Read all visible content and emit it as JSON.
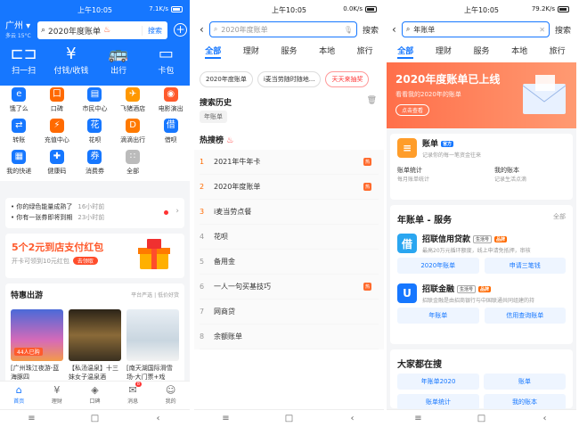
{
  "status_bars": [
    {
      "time": "上午10:05",
      "net": "7.1K/s",
      "battery": "77"
    },
    {
      "time": "上午10:05",
      "net": "0.0K/s",
      "battery": "77"
    },
    {
      "time": "上午10:05",
      "net": "79.2K/s",
      "battery": "77"
    }
  ],
  "p1": {
    "city": "广州",
    "weather": "多云 15°C",
    "search_text": "2020年度账单",
    "search_btn": "搜索",
    "big": [
      {
        "label": "扫一扫",
        "icon": "scan-icon"
      },
      {
        "label": "付钱/收钱",
        "icon": "pay-icon"
      },
      {
        "label": "出行",
        "icon": "bus-icon"
      },
      {
        "label": "卡包",
        "icon": "card-icon"
      }
    ],
    "grid": [
      {
        "label": "饿了么",
        "icon": "eleme-icon",
        "color": "#1677ff"
      },
      {
        "label": "口碑",
        "icon": "koubei-icon",
        "color": "#ff6a00"
      },
      {
        "label": "市民中心",
        "icon": "citizen-icon",
        "color": "#1677ff"
      },
      {
        "label": "飞猪酒店",
        "icon": "hotel-icon",
        "color": "#ff9800"
      },
      {
        "label": "电影演出",
        "icon": "movie-icon",
        "color": "#ff5a2c"
      },
      {
        "label": "转账",
        "icon": "transfer-icon",
        "color": "#1677ff"
      },
      {
        "label": "充值中心",
        "icon": "topup-icon",
        "color": "#ff6a00"
      },
      {
        "label": "花呗",
        "icon": "huabei-icon",
        "color": "#1677ff"
      },
      {
        "label": "滴滴出行",
        "icon": "didi-icon",
        "color": "#ff7a00"
      },
      {
        "label": "借呗",
        "icon": "jiebei-icon",
        "color": "#1677ff"
      },
      {
        "label": "我的快递",
        "icon": "express-icon",
        "color": "#1677ff"
      },
      {
        "label": "健康码",
        "icon": "health-code-icon",
        "color": "#1677ff"
      },
      {
        "label": "消费券",
        "icon": "coupon-icon",
        "color": "#1677ff"
      },
      {
        "label": "全部",
        "icon": "all-icon",
        "color": "#bbb"
      }
    ],
    "notices": [
      {
        "text": "你的绿色能量成熟了",
        "time": "16小时前"
      },
      {
        "text": "你有一张券即将到期",
        "time": "23小时前"
      }
    ],
    "promo": {
      "title": "5个2元到店支付红包",
      "sub": "开卡可领到10元红包",
      "go": "去领取"
    },
    "travel": {
      "title": "特惠出游",
      "tags": "平台严选 | 低价好货",
      "badge": "44人已购",
      "items": [
        {
          "cap": "[广州珠江夜游-蓝海豚四"
        },
        {
          "cap": "【私汤温泉】十三妹女子温泉酒"
        },
        {
          "cap": "[南天湖国际滑雪场-大门票+戏"
        }
      ]
    },
    "tabs": [
      {
        "label": "首页",
        "icon": "home-icon"
      },
      {
        "label": "理财",
        "icon": "finance-icon"
      },
      {
        "label": "口碑",
        "icon": "koubei-tab-icon"
      },
      {
        "label": "消息",
        "icon": "message-icon",
        "badge": "8"
      },
      {
        "label": "我的",
        "icon": "profile-icon"
      }
    ]
  },
  "p2": {
    "search_text": "2020年度账单",
    "search_btn": "搜索",
    "tabs": [
      "全部",
      "理财",
      "服务",
      "本地",
      "旅行"
    ],
    "chips": [
      "2020年度账单",
      "i麦当劳随时随地...",
      "天天来抽奖"
    ],
    "history_title": "搜索历史",
    "history": [
      "年账单"
    ],
    "hot_title": "热搜榜",
    "hot": [
      {
        "n": "1",
        "t": "2021年牛年卡",
        "tag": "热"
      },
      {
        "n": "2",
        "t": "2020年度账单",
        "tag": "热"
      },
      {
        "n": "3",
        "t": "i麦当劳点餐",
        "tag": ""
      },
      {
        "n": "4",
        "t": "花呗",
        "tag": ""
      },
      {
        "n": "5",
        "t": "备用金",
        "tag": ""
      },
      {
        "n": "6",
        "t": "一人一句买基技巧",
        "tag": "热"
      },
      {
        "n": "7",
        "t": "网商贷",
        "tag": ""
      },
      {
        "n": "8",
        "t": "余额账单",
        "tag": ""
      }
    ]
  },
  "p3": {
    "search_text": "年账单",
    "search_btn": "搜索",
    "tabs": [
      "全部",
      "理财",
      "服务",
      "本地",
      "旅行"
    ],
    "banner": {
      "title": "2020年度账单已上线",
      "sub": "看看我的2020年的账单",
      "btn": "点击查看"
    },
    "bill": {
      "name": "账单",
      "badge": "官方",
      "desc": "记录你的每一笔资金往来",
      "a": "账单统计",
      "a_sub": "每月账单统计",
      "b": "我的账本",
      "b_sub": "记录生活点滴"
    },
    "svc_title": "年账单 - 服务",
    "svc_all": "全部",
    "svcs": [
      {
        "name": "招联信用贷款",
        "badge1": "生活号",
        "badge2": "品牌",
        "desc": "最高20万元循环额度，线上申请免抵押，审核",
        "logo_text": "借",
        "logo_color": "#2aa6f0",
        "btns": [
          "2020年账单",
          "申请三笔钱"
        ]
      },
      {
        "name": "招联金融",
        "badge1": "生活号",
        "badge2": "品牌",
        "desc": "招联金融是由招商银行与中国联通共同组建的持",
        "logo_text": "U",
        "logo_color": "#1677ff",
        "btns": [
          "年账单",
          "信用查询账单"
        ]
      }
    ],
    "pop_title": "大家都在搜",
    "pop": [
      "年账单2020",
      "账单",
      "账单统计",
      "我的账本"
    ]
  }
}
